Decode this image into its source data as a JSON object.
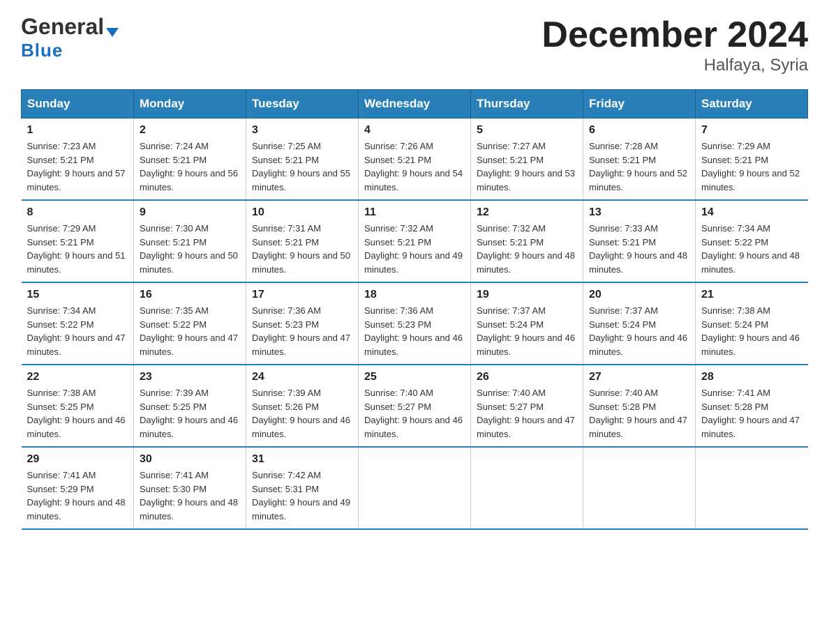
{
  "logo": {
    "line1": "General",
    "line2": "Blue"
  },
  "title": "December 2024",
  "subtitle": "Halfaya, Syria",
  "days": [
    "Sunday",
    "Monday",
    "Tuesday",
    "Wednesday",
    "Thursday",
    "Friday",
    "Saturday"
  ],
  "weeks": [
    [
      {
        "num": "1",
        "sunrise": "7:23 AM",
        "sunset": "5:21 PM",
        "daylight": "9 hours and 57 minutes."
      },
      {
        "num": "2",
        "sunrise": "7:24 AM",
        "sunset": "5:21 PM",
        "daylight": "9 hours and 56 minutes."
      },
      {
        "num": "3",
        "sunrise": "7:25 AM",
        "sunset": "5:21 PM",
        "daylight": "9 hours and 55 minutes."
      },
      {
        "num": "4",
        "sunrise": "7:26 AM",
        "sunset": "5:21 PM",
        "daylight": "9 hours and 54 minutes."
      },
      {
        "num": "5",
        "sunrise": "7:27 AM",
        "sunset": "5:21 PM",
        "daylight": "9 hours and 53 minutes."
      },
      {
        "num": "6",
        "sunrise": "7:28 AM",
        "sunset": "5:21 PM",
        "daylight": "9 hours and 52 minutes."
      },
      {
        "num": "7",
        "sunrise": "7:29 AM",
        "sunset": "5:21 PM",
        "daylight": "9 hours and 52 minutes."
      }
    ],
    [
      {
        "num": "8",
        "sunrise": "7:29 AM",
        "sunset": "5:21 PM",
        "daylight": "9 hours and 51 minutes."
      },
      {
        "num": "9",
        "sunrise": "7:30 AM",
        "sunset": "5:21 PM",
        "daylight": "9 hours and 50 minutes."
      },
      {
        "num": "10",
        "sunrise": "7:31 AM",
        "sunset": "5:21 PM",
        "daylight": "9 hours and 50 minutes."
      },
      {
        "num": "11",
        "sunrise": "7:32 AM",
        "sunset": "5:21 PM",
        "daylight": "9 hours and 49 minutes."
      },
      {
        "num": "12",
        "sunrise": "7:32 AM",
        "sunset": "5:21 PM",
        "daylight": "9 hours and 48 minutes."
      },
      {
        "num": "13",
        "sunrise": "7:33 AM",
        "sunset": "5:21 PM",
        "daylight": "9 hours and 48 minutes."
      },
      {
        "num": "14",
        "sunrise": "7:34 AM",
        "sunset": "5:22 PM",
        "daylight": "9 hours and 48 minutes."
      }
    ],
    [
      {
        "num": "15",
        "sunrise": "7:34 AM",
        "sunset": "5:22 PM",
        "daylight": "9 hours and 47 minutes."
      },
      {
        "num": "16",
        "sunrise": "7:35 AM",
        "sunset": "5:22 PM",
        "daylight": "9 hours and 47 minutes."
      },
      {
        "num": "17",
        "sunrise": "7:36 AM",
        "sunset": "5:23 PM",
        "daylight": "9 hours and 47 minutes."
      },
      {
        "num": "18",
        "sunrise": "7:36 AM",
        "sunset": "5:23 PM",
        "daylight": "9 hours and 46 minutes."
      },
      {
        "num": "19",
        "sunrise": "7:37 AM",
        "sunset": "5:24 PM",
        "daylight": "9 hours and 46 minutes."
      },
      {
        "num": "20",
        "sunrise": "7:37 AM",
        "sunset": "5:24 PM",
        "daylight": "9 hours and 46 minutes."
      },
      {
        "num": "21",
        "sunrise": "7:38 AM",
        "sunset": "5:24 PM",
        "daylight": "9 hours and 46 minutes."
      }
    ],
    [
      {
        "num": "22",
        "sunrise": "7:38 AM",
        "sunset": "5:25 PM",
        "daylight": "9 hours and 46 minutes."
      },
      {
        "num": "23",
        "sunrise": "7:39 AM",
        "sunset": "5:25 PM",
        "daylight": "9 hours and 46 minutes."
      },
      {
        "num": "24",
        "sunrise": "7:39 AM",
        "sunset": "5:26 PM",
        "daylight": "9 hours and 46 minutes."
      },
      {
        "num": "25",
        "sunrise": "7:40 AM",
        "sunset": "5:27 PM",
        "daylight": "9 hours and 46 minutes."
      },
      {
        "num": "26",
        "sunrise": "7:40 AM",
        "sunset": "5:27 PM",
        "daylight": "9 hours and 47 minutes."
      },
      {
        "num": "27",
        "sunrise": "7:40 AM",
        "sunset": "5:28 PM",
        "daylight": "9 hours and 47 minutes."
      },
      {
        "num": "28",
        "sunrise": "7:41 AM",
        "sunset": "5:28 PM",
        "daylight": "9 hours and 47 minutes."
      }
    ],
    [
      {
        "num": "29",
        "sunrise": "7:41 AM",
        "sunset": "5:29 PM",
        "daylight": "9 hours and 48 minutes."
      },
      {
        "num": "30",
        "sunrise": "7:41 AM",
        "sunset": "5:30 PM",
        "daylight": "9 hours and 48 minutes."
      },
      {
        "num": "31",
        "sunrise": "7:42 AM",
        "sunset": "5:31 PM",
        "daylight": "9 hours and 49 minutes."
      },
      null,
      null,
      null,
      null
    ]
  ]
}
